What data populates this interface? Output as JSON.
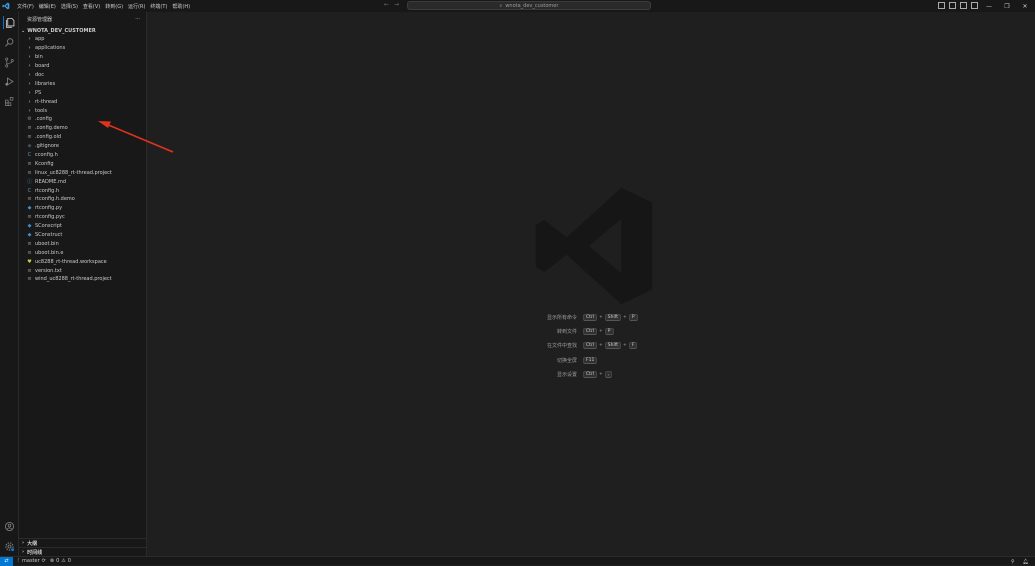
{
  "titlebar": {
    "menus": [
      "文件(F)",
      "编辑(E)",
      "选择(S)",
      "查看(V)",
      "转到(G)",
      "运行(R)",
      "终端(T)",
      "帮助(H)"
    ],
    "search": "wnota_dev_customer"
  },
  "sidebar": {
    "title": "资源管理器",
    "more": "···",
    "project": "WNOTA_DEV_CUSTOMER",
    "items": [
      {
        "label": "app",
        "icon": "chevron-right-icon",
        "glyph": "›"
      },
      {
        "label": "applications",
        "icon": "chevron-right-icon",
        "glyph": "›"
      },
      {
        "label": "bin",
        "icon": "chevron-right-icon",
        "glyph": "›"
      },
      {
        "label": "board",
        "icon": "chevron-right-icon",
        "glyph": "›"
      },
      {
        "label": "doc",
        "icon": "chevron-right-icon",
        "glyph": "›"
      },
      {
        "label": "libraries",
        "icon": "chevron-right-icon",
        "glyph": "›"
      },
      {
        "label": "PS",
        "icon": "chevron-right-icon",
        "glyph": "›"
      },
      {
        "label": "rt-thread",
        "icon": "chevron-right-icon",
        "glyph": "›"
      },
      {
        "label": "tools",
        "icon": "chevron-right-icon",
        "glyph": "›"
      },
      {
        "label": ".config",
        "icon": "gear-icon",
        "glyph": "⚙"
      },
      {
        "label": ".config.demo",
        "icon": "lines-icon",
        "glyph": "≡"
      },
      {
        "label": ".config.old",
        "icon": "lines-icon",
        "glyph": "≡"
      },
      {
        "label": ".gitignore",
        "icon": "git-icon",
        "glyph": "◆"
      },
      {
        "label": "cconfig.h",
        "icon": "c-file-icon",
        "glyph": "C"
      },
      {
        "label": "Kconfig",
        "icon": "lines-icon",
        "glyph": "≡"
      },
      {
        "label": "linux_uc8288_rt-thread.project",
        "icon": "lines-icon",
        "glyph": "≡"
      },
      {
        "label": "README.md",
        "icon": "info-icon",
        "glyph": "ⓘ"
      },
      {
        "label": "rtconfig.h",
        "icon": "c-file-icon",
        "glyph": "C"
      },
      {
        "label": "rtconfig.h.demo",
        "icon": "lines-icon",
        "glyph": "≡"
      },
      {
        "label": "rtconfig.py",
        "icon": "python-icon",
        "glyph": "◆"
      },
      {
        "label": "rtconfig.pyc",
        "icon": "lines-icon",
        "glyph": "≡"
      },
      {
        "label": "SConscript",
        "icon": "python-icon",
        "glyph": "◆"
      },
      {
        "label": "SConstruct",
        "icon": "python-icon",
        "glyph": "◆"
      },
      {
        "label": "uboot.bin",
        "icon": "lines-icon",
        "glyph": "≡"
      },
      {
        "label": "uboot.bin.e",
        "icon": "lines-icon",
        "glyph": "≡"
      },
      {
        "label": "uc8288_rt-thread.workspace",
        "icon": "heart-icon",
        "glyph": "♥"
      },
      {
        "label": "version.txt",
        "icon": "lines-icon",
        "glyph": "≡"
      },
      {
        "label": "wind_uc8288_rt-thread.project",
        "icon": "lines-icon",
        "glyph": "≡"
      }
    ],
    "sections": [
      "大纲",
      "时间线"
    ]
  },
  "editor": {
    "shortcuts": [
      {
        "label": "显示所有命令",
        "keys": [
          "Ctrl",
          "Shift",
          "P"
        ]
      },
      {
        "label": "转到文件",
        "keys": [
          "Ctrl",
          "P"
        ]
      },
      {
        "label": "在文件中查找",
        "keys": [
          "Ctrl",
          "Shift",
          "F"
        ]
      },
      {
        "label": "切换全屏",
        "keys": [
          "F11"
        ]
      },
      {
        "label": "显示设置",
        "keys": [
          "Ctrl",
          ","
        ]
      }
    ]
  },
  "statusbar": {
    "branch": "master",
    "errors": "0",
    "warnings": "0"
  },
  "colors": {
    "accent": "#0078d4",
    "annotation_arrow": "#e0321e"
  }
}
